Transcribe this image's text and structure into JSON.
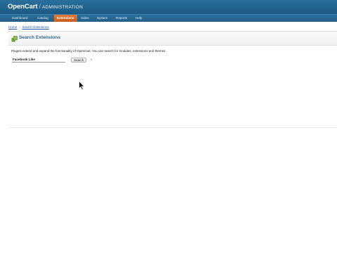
{
  "header": {
    "logo_brand": "OpenCart",
    "logo_separator": "/",
    "logo_section": "ADMINISTRATION"
  },
  "menu": [
    {
      "label": "Dashboard",
      "active": false
    },
    {
      "label": "Catalog",
      "active": false
    },
    {
      "label": "Extensions",
      "active": true
    },
    {
      "label": "Sales",
      "active": false
    },
    {
      "label": "System",
      "active": false
    },
    {
      "label": "Reports",
      "active": false
    },
    {
      "label": "Help",
      "active": false
    }
  ],
  "breadcrumb": {
    "home": "Home",
    "separator": "::",
    "current": "Search Extensions"
  },
  "page": {
    "title": "Search Extensions",
    "title_icon": "extension-icon",
    "intro": "Plugins extend and expand the functionality of OpenCart. You can search for modules, extensions and themes."
  },
  "search": {
    "value": "Facebook Like",
    "button_label": "Search",
    "clear_label": "x"
  },
  "colors": {
    "header": "#1c5a84",
    "active_tab": "#d2672a",
    "title": "#2c6593",
    "link": "#1b57a6"
  }
}
